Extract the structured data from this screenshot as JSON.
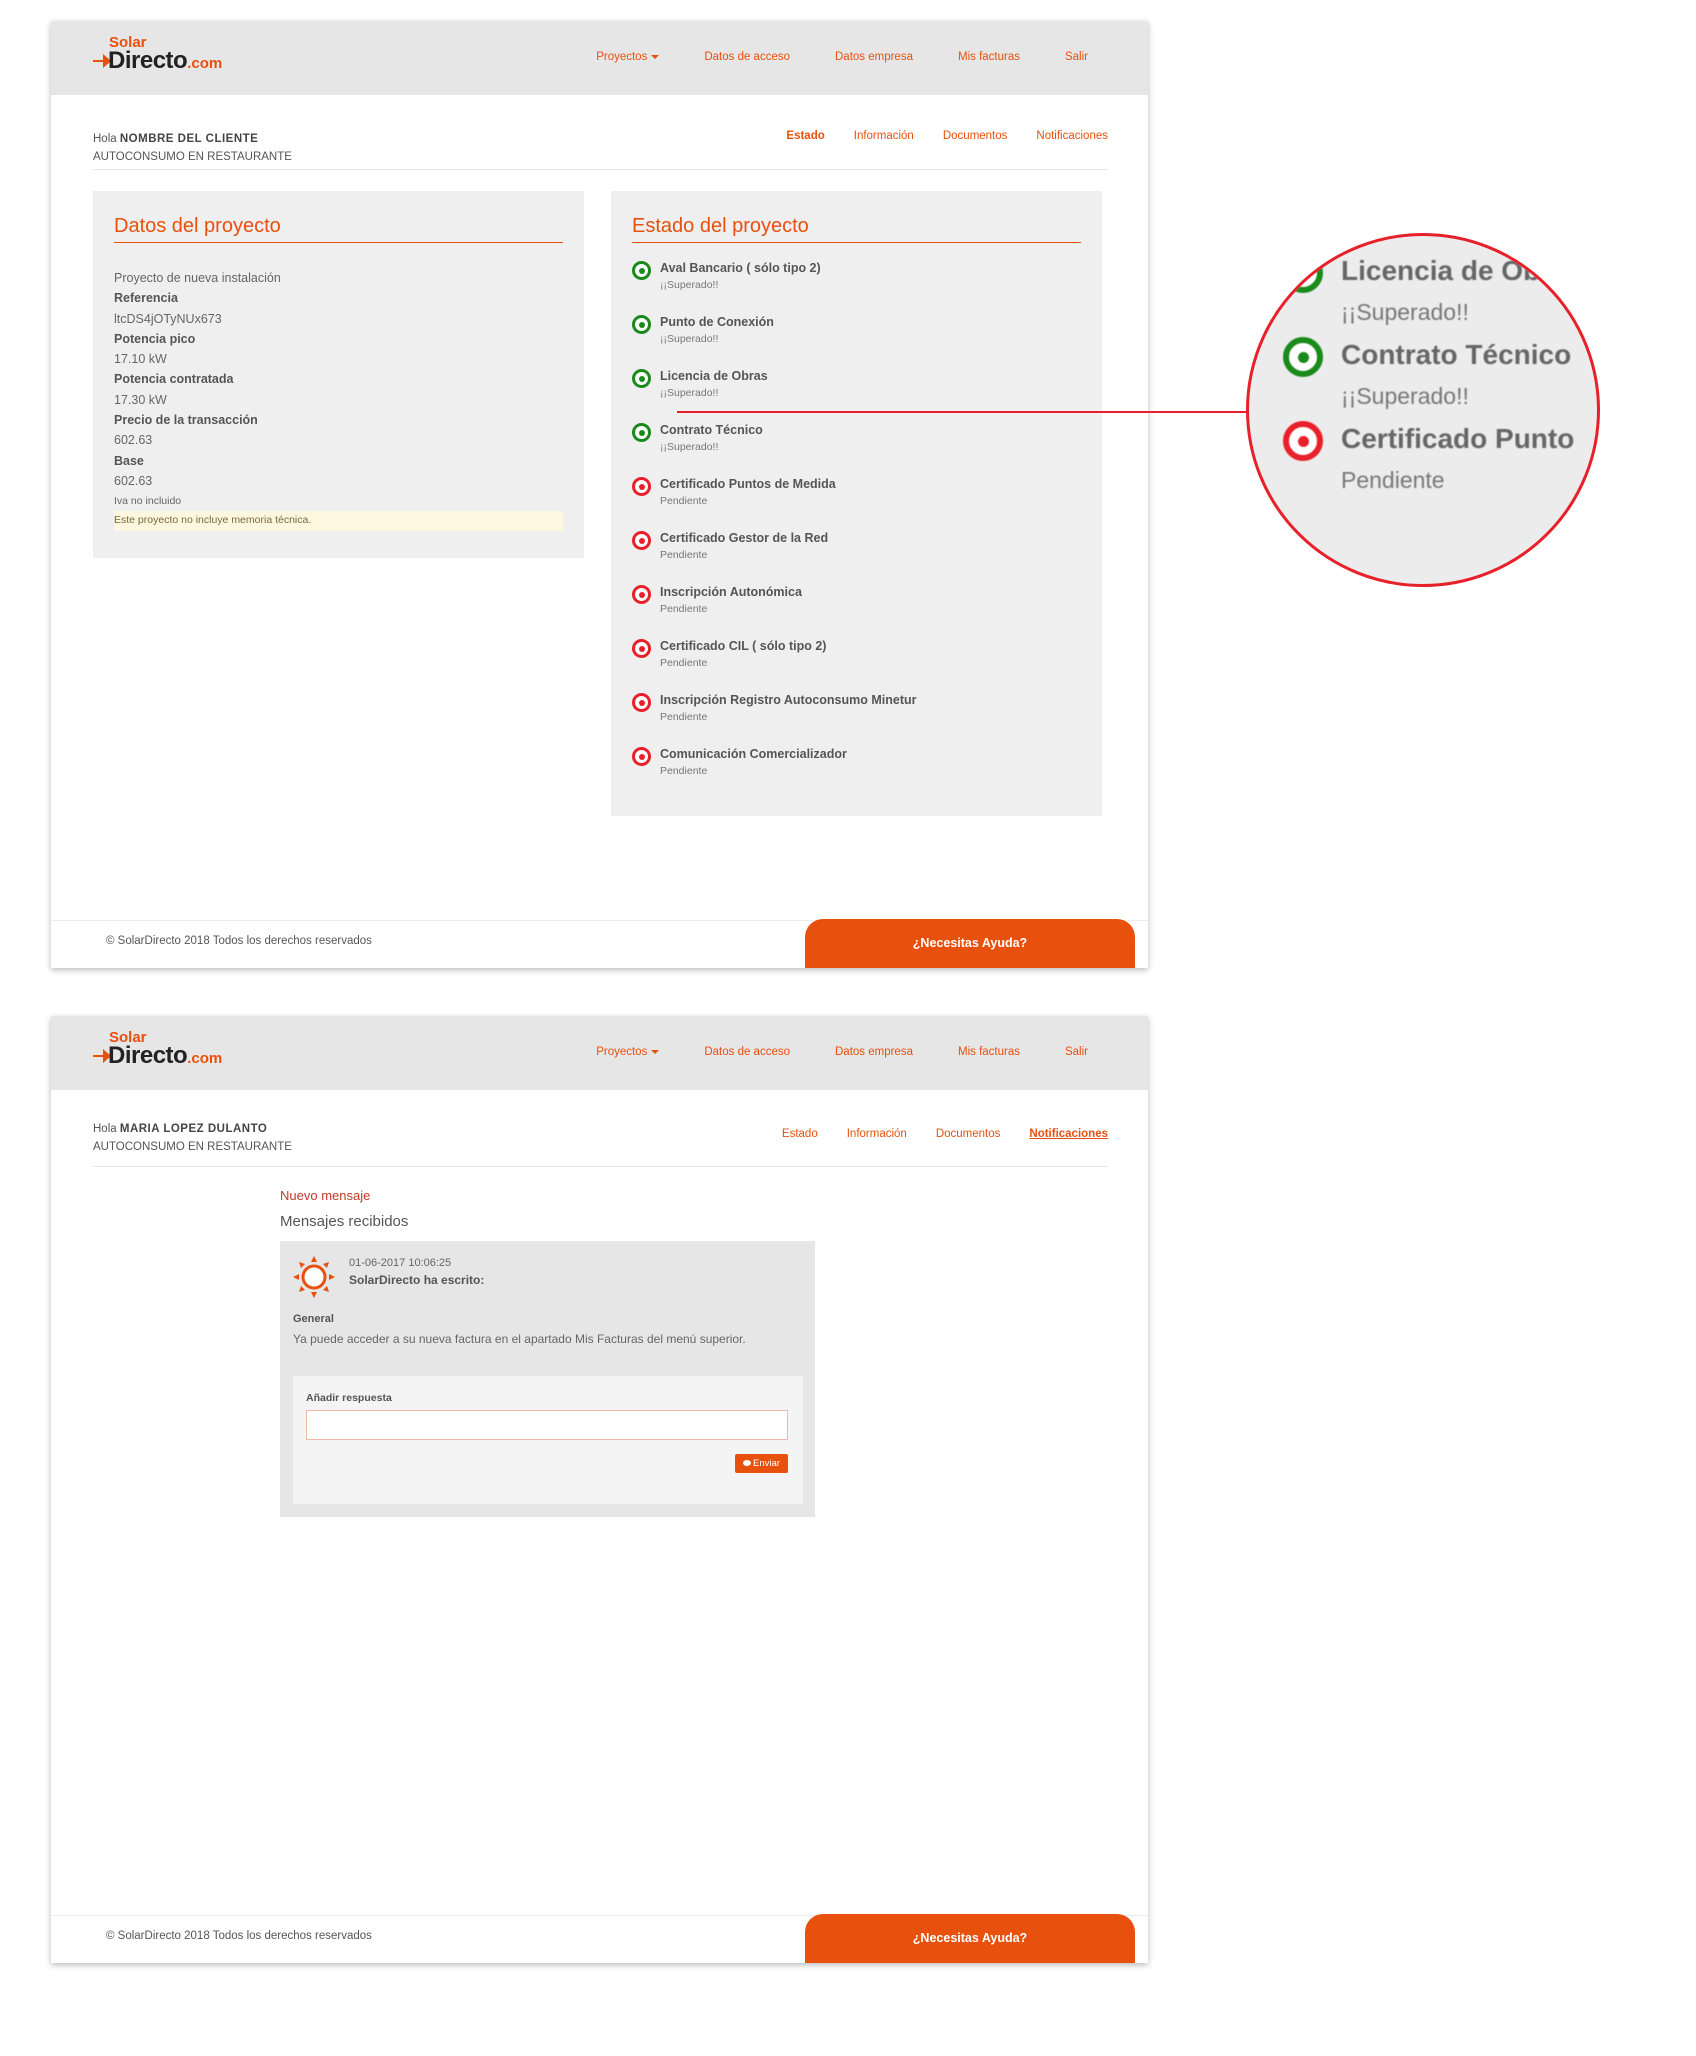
{
  "brand": {
    "solar": "Solar",
    "directo": "Directo",
    "com": ".com",
    "accent": "#e8500d",
    "success": "#1a8a1a",
    "pending": "#e8202a"
  },
  "nav": {
    "proyectos": "Proyectos",
    "acceso": "Datos de acceso",
    "empresa": "Datos empresa",
    "facturas": "Mis facturas",
    "salir": "Salir"
  },
  "tabs": {
    "estado": "Estado",
    "informacion": "Información",
    "documentos": "Documentos",
    "notificaciones": "Notificaciones"
  },
  "screen1": {
    "greeting": "Hola",
    "client_name": "NOMBRE DEL CLIENTE",
    "project_name": "AUTOCONSUMO EN RESTAURANTE",
    "datos": {
      "title": "Datos del proyecto",
      "type": "Proyecto de nueva instalación",
      "ref_label": "Referencia",
      "ref_value": "ltcDS4jOTyNUx673",
      "pico_label": "Potencia pico",
      "pico_value": "17.10 kW",
      "contratada_label": "Potencia contratada",
      "contratada_value": "17.30 kW",
      "precio_label": "Precio de la transacción",
      "precio_value": "602.63",
      "base_label": "Base",
      "base_value": "602.63",
      "iva": "Iva no incluido",
      "note": "Este proyecto no incluye memoria técnica."
    },
    "estado": {
      "title": "Estado del proyecto",
      "steps": [
        {
          "title": "Aval Bancario ( sólo tipo 2)",
          "status": "¡¡Superado!!"
        },
        {
          "title": "Punto de Conexión",
          "status": "¡¡Superado!!"
        },
        {
          "title": "Licencia de Obras",
          "status": "¡¡Superado!!"
        },
        {
          "title": "Contrato Técnico",
          "status": "¡¡Superado!!"
        },
        {
          "title": "Certificado Puntos de Medida",
          "status": "Pendiente"
        },
        {
          "title": "Certificado Gestor de la Red",
          "status": "Pendiente"
        },
        {
          "title": "Inscripción Autonómica",
          "status": "Pendiente"
        },
        {
          "title": "Certificado CIL ( sólo tipo 2)",
          "status": "Pendiente"
        },
        {
          "title": "Inscripción Registro Autoconsumo Minetur",
          "status": "Pendiente"
        },
        {
          "title": "Comunicación Comercializador",
          "status": "Pendiente"
        }
      ]
    }
  },
  "magnifier": {
    "items": [
      {
        "title": "Licencia de Obra",
        "status": "¡¡Superado!!"
      },
      {
        "title": "Contrato Técnico",
        "status": "¡¡Superado!!"
      },
      {
        "title": "Certificado Punto",
        "status": "Pendiente"
      }
    ]
  },
  "screen2": {
    "greeting": "Hola",
    "client_name": "MARIA LOPEZ DULANTO",
    "project_name": "AUTOCONSUMO EN RESTAURANTE",
    "new_message": "Nuevo mensaje",
    "received_title": "Mensajes recibidos",
    "message": {
      "date": "01-06-2017 10:06:25",
      "author": "SolarDirecto ha escrito:",
      "category": "General",
      "body": "Ya puede acceder a su nueva factura en el apartado Mis Facturas del menú superior."
    },
    "reply_label": "Añadir respuesta",
    "reply_value": "",
    "send_label": "Enviar"
  },
  "footer": {
    "copyright": "© SolarDirecto 2018 Todos los derechos reservados",
    "help": "¿Necesitas Ayuda?"
  }
}
